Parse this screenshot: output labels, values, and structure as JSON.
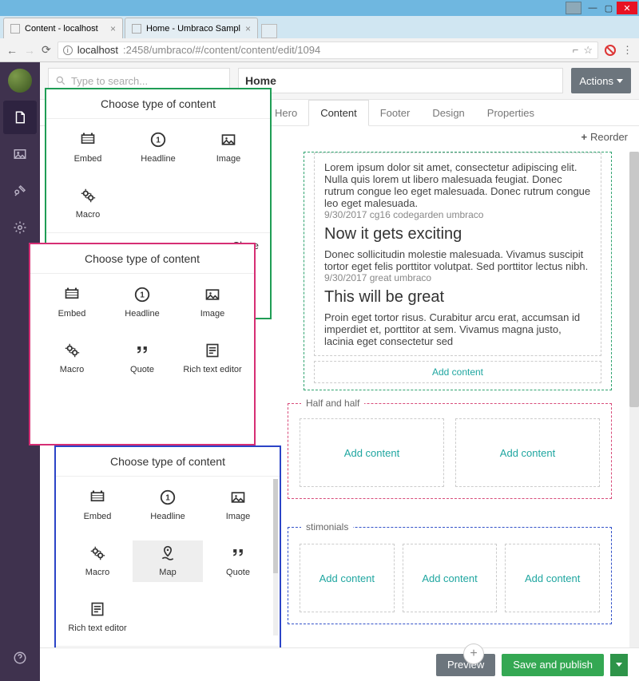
{
  "browser": {
    "tabs": [
      {
        "title": "Content - localhost"
      },
      {
        "title": "Home - Umbraco Sampl"
      }
    ],
    "url_host": "localhost",
    "url_path": ":2458/umbraco/#/content/content/edit/1094"
  },
  "search": {
    "placeholder": "Type to search..."
  },
  "page_title": "Home",
  "actions_label": "Actions",
  "tabs": [
    "Hero",
    "Content",
    "Footer",
    "Design",
    "Properties"
  ],
  "active_tab": "Content",
  "reorder_label": "Reorder",
  "blog": {
    "para1": "Lorem ipsum dolor sit amet, consectetur adipiscing elit. Nulla quis lorem ut libero malesuada feugiat. Donec rutrum congue leo eget malesuada. Donec rutrum congue leo eget malesuada.",
    "meta1": "9/30/2017 cg16 codegarden umbraco",
    "h2": "Now it gets exciting",
    "para2": "Donec sollicitudin molestie malesuada. Vivamus suscipit tortor eget felis porttitor volutpat. Sed porttitor lectus nibh.",
    "meta2": "9/30/2017 great umbraco",
    "h3": "This will be great",
    "para3": "Proin eget tortor risus. Curabitur arcu erat, accumsan id imperdiet et, porttitor at sem. Vivamus magna justo, lacinia eget consectetur sed",
    "add": "Add content"
  },
  "half": {
    "legend": "Half and half",
    "add": "Add content"
  },
  "testimonials": {
    "legend": "stimonials",
    "add": "Add content"
  },
  "choosers": {
    "title": "Choose type of content",
    "close": "Close",
    "green": [
      {
        "icon": "embed",
        "label": "Embed"
      },
      {
        "icon": "headline",
        "label": "Headline"
      },
      {
        "icon": "image",
        "label": "Image"
      },
      {
        "icon": "macro",
        "label": "Macro"
      }
    ],
    "pink": [
      {
        "icon": "embed",
        "label": "Embed"
      },
      {
        "icon": "headline",
        "label": "Headline"
      },
      {
        "icon": "image",
        "label": "Image"
      },
      {
        "icon": "macro",
        "label": "Macro"
      },
      {
        "icon": "quote",
        "label": "Quote"
      },
      {
        "icon": "rte",
        "label": "Rich text editor"
      }
    ],
    "blue": [
      {
        "icon": "embed",
        "label": "Embed"
      },
      {
        "icon": "headline",
        "label": "Headline"
      },
      {
        "icon": "image",
        "label": "Image"
      },
      {
        "icon": "macro",
        "label": "Macro"
      },
      {
        "icon": "map",
        "label": "Map",
        "selected": true
      },
      {
        "icon": "quote",
        "label": "Quote"
      },
      {
        "icon": "rte",
        "label": "Rich text editor"
      }
    ]
  },
  "footer": {
    "preview": "Preview",
    "publish": "Save and publish"
  }
}
